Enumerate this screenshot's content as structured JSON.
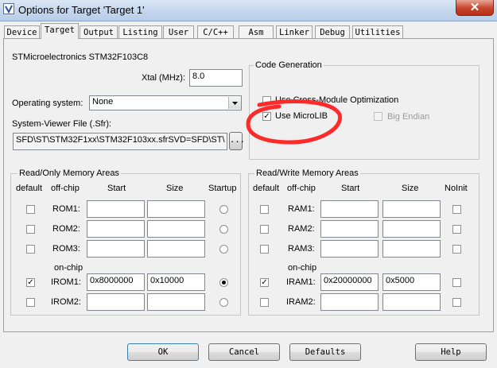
{
  "window": {
    "title": "Options for Target 'Target 1'",
    "close_glyph": "✕"
  },
  "tabs": [
    "Device",
    "Target",
    "Output",
    "Listing",
    "User",
    "C/C++",
    "Asm",
    "Linker",
    "Debug",
    "Utilities"
  ],
  "device": {
    "name": "STMicroelectronics STM32F103C8"
  },
  "xtal": {
    "label": "Xtal (MHz):",
    "value": "8.0"
  },
  "os": {
    "label": "Operating system:",
    "value": "None"
  },
  "sfr": {
    "label": "System-Viewer File (.Sfr):",
    "value": "SFD\\ST\\STM32F1xx\\STM32F103xx.sfrSVD=SFD\\ST\\",
    "browse": "..."
  },
  "codegen": {
    "title": "Code Generation",
    "cross_module": "Use Cross-Module Optimization",
    "microlib": "Use MicroLIB",
    "microlib_checked": true,
    "big_endian": "Big Endian"
  },
  "ro_mem": {
    "title": "Read/Only Memory Areas",
    "headers": {
      "default": "default",
      "offchip": "off-chip",
      "start": "Start",
      "size": "Size",
      "startup": "Startup"
    },
    "onchip": "on-chip",
    "rows": [
      {
        "name": "ROM1:",
        "start": "",
        "size": "",
        "default": false,
        "startup": false
      },
      {
        "name": "ROM2:",
        "start": "",
        "size": "",
        "default": false,
        "startup": false
      },
      {
        "name": "ROM3:",
        "start": "",
        "size": "",
        "default": false,
        "startup": false
      },
      {
        "name": "IROM1:",
        "start": "0x8000000",
        "size": "0x10000",
        "default": true,
        "startup": true
      },
      {
        "name": "IROM2:",
        "start": "",
        "size": "",
        "default": false,
        "startup": false
      }
    ]
  },
  "rw_mem": {
    "title": "Read/Write Memory Areas",
    "headers": {
      "default": "default",
      "offchip": "off-chip",
      "start": "Start",
      "size": "Size",
      "noinit": "NoInit"
    },
    "onchip": "on-chip",
    "rows": [
      {
        "name": "RAM1:",
        "start": "",
        "size": "",
        "default": false
      },
      {
        "name": "RAM2:",
        "start": "",
        "size": "",
        "default": false
      },
      {
        "name": "RAM3:",
        "start": "",
        "size": "",
        "default": false
      },
      {
        "name": "IRAM1:",
        "start": "0x20000000",
        "size": "0x5000",
        "default": true
      },
      {
        "name": "IRAM2:",
        "start": "",
        "size": "",
        "default": false
      }
    ]
  },
  "buttons": {
    "ok": "OK",
    "cancel": "Cancel",
    "defaults": "Defaults",
    "help": "Help"
  },
  "check_glyph": "✓",
  "annotation_color": "#ff2a2a"
}
